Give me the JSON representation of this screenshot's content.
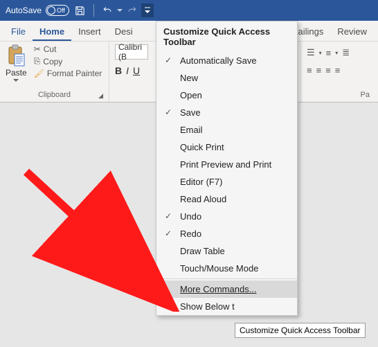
{
  "titlebar": {
    "autosave_label": "AutoSave",
    "autosave_state": "Off"
  },
  "tabs": {
    "file": "File",
    "home": "Home",
    "insert": "Insert",
    "design": "Desi",
    "mailings": "ailings",
    "review": "Review"
  },
  "ribbon": {
    "clipboard": {
      "paste": "Paste",
      "cut": "Cut",
      "copy": "Copy",
      "format_painter": "Format Painter",
      "label": "Clipboard"
    },
    "font": {
      "name": "Calibri (B",
      "bold": "B",
      "italic": "I",
      "underline": "U"
    },
    "paragraph": {
      "label": "Pa"
    }
  },
  "dropdown": {
    "title": "Customize Quick Access Toolbar",
    "items": [
      {
        "label": "Automatically Save",
        "checked": true
      },
      {
        "label": "New",
        "checked": false
      },
      {
        "label": "Open",
        "checked": false
      },
      {
        "label": "Save",
        "checked": true
      },
      {
        "label": "Email",
        "checked": false
      },
      {
        "label": "Quick Print",
        "checked": false
      },
      {
        "label": "Print Preview and Print",
        "checked": false
      },
      {
        "label": "Editor (F7)",
        "checked": false
      },
      {
        "label": "Read Aloud",
        "checked": false
      },
      {
        "label": "Undo",
        "checked": true
      },
      {
        "label": "Redo",
        "checked": true
      },
      {
        "label": "Draw Table",
        "checked": false
      },
      {
        "label": "Touch/Mouse Mode",
        "checked": false
      }
    ],
    "more_commands": "More Commands...",
    "show_below": "Show Below t"
  },
  "tooltip": {
    "text": "Customize Quick Access Toolbar"
  }
}
